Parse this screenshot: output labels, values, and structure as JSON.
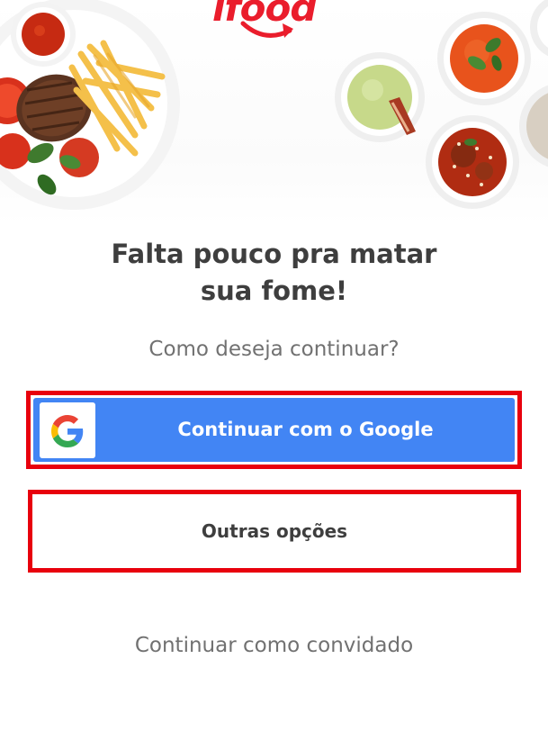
{
  "brand": {
    "logo_text": "ifood",
    "accent_color": "#ea1d2c"
  },
  "hero": {
    "illustration": "food-plates-illustration"
  },
  "login": {
    "title_line1": "Falta pouco pra matar",
    "title_line2": "sua fome!",
    "subtitle": "Como deseja continuar?",
    "google_button_label": "Continuar com o Google",
    "google_button_color": "#4285f4",
    "google_icon": "google-g-icon",
    "other_options_label": "Outras opções",
    "guest_label": "Continuar como convidado",
    "highlight_color": "#e8000d"
  }
}
